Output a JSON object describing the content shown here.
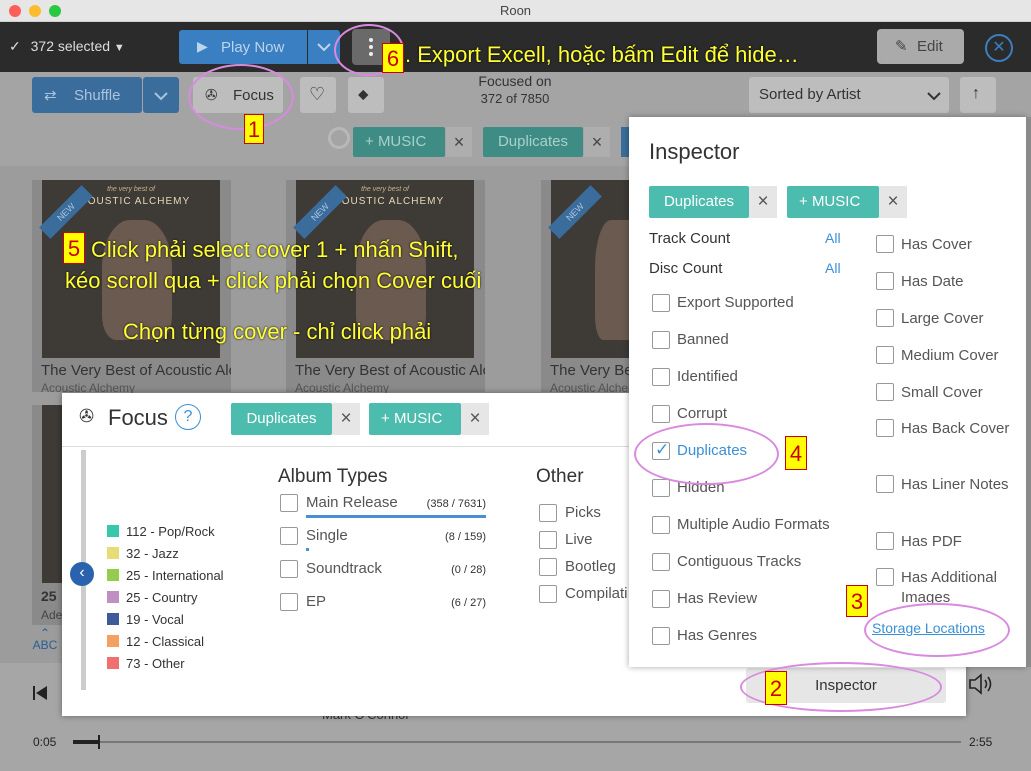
{
  "window": {
    "title": "Roon"
  },
  "toolbar": {
    "selection_label": "372 selected",
    "play_now_label": "Play Now",
    "edit_label": "Edit"
  },
  "filterbar": {
    "shuffle_label": "Shuffle",
    "focus_label": "Focus",
    "focused_on_line1": "Focused on",
    "focused_on_line2": "372 of 7850",
    "sort_label": "Sorted by Artist",
    "chips": [
      "MUSIC",
      "Duplicates"
    ]
  },
  "albums": [
    {
      "title": "The Very Best of Acoustic Alchemy",
      "artist": "Acoustic Alchemy",
      "badge": "NEW",
      "cover_text": "ACOUSTIC ALCHEMY",
      "cover_sub": "the very best of"
    },
    {
      "title": "The Very Best of Acoustic Alchemy",
      "artist": "Acoustic Alchemy",
      "badge": "NEW",
      "cover_text": "ACOUSTIC ALCHEMY",
      "cover_sub": "the very best of"
    },
    {
      "title": "The Very Best of Acoustic Alchemy",
      "artist": "Acoustic Alchemy",
      "badge": "NEW",
      "cover_text": "ACOUSTIC ALCHEMY",
      "cover_sub": "the very best of"
    }
  ],
  "side_partial": {
    "count": "25",
    "artist": "Ade"
  },
  "abc_label": "ABC",
  "focus_panel": {
    "title": "Focus",
    "help": "?",
    "chips": [
      "Duplicates",
      "MUSIC"
    ],
    "legend": [
      {
        "label": "112 - Pop/Rock",
        "color": "#36c8a8"
      },
      {
        "label": "32 - Jazz",
        "color": "#e8dc78"
      },
      {
        "label": "25 - International",
        "color": "#94cc50"
      },
      {
        "label": "25 - Country",
        "color": "#c08ec2"
      },
      {
        "label": "19 - Vocal",
        "color": "#3e5a98"
      },
      {
        "label": "12 - Classical",
        "color": "#f4a060"
      },
      {
        "label": "73 - Other",
        "color": "#f07070"
      }
    ],
    "album_types_heading": "Album Types",
    "album_types": [
      {
        "label": "Main Release",
        "count": "(358 / 7631)",
        "fraction": 1.0
      },
      {
        "label": "Single",
        "count": "(8 / 159)",
        "fraction": 0.02
      },
      {
        "label": "Soundtrack",
        "count": "(0 / 28)",
        "fraction": 0
      },
      {
        "label": "EP",
        "count": "(6 / 27)",
        "fraction": 0
      }
    ],
    "other_heading": "Other",
    "other": [
      "Picks",
      "Live",
      "Bootleg",
      "Compilati"
    ]
  },
  "inspector": {
    "title": "Inspector",
    "chips": [
      "Duplicates",
      "MUSIC"
    ],
    "track_count_label": "Track Count",
    "disc_count_label": "Disc Count",
    "all_label": "All",
    "left_checks": [
      {
        "label": "Export Supported",
        "checked": false
      },
      {
        "label": "Banned",
        "checked": false
      },
      {
        "label": "Identified",
        "checked": false
      },
      {
        "label": "Corrupt",
        "checked": false
      },
      {
        "label": "Duplicates",
        "checked": true
      },
      {
        "label": "Hidden",
        "checked": false
      },
      {
        "label": "Multiple Audio Formats",
        "checked": false
      },
      {
        "label": "Contiguous Tracks",
        "checked": false
      },
      {
        "label": "Has Review",
        "checked": false
      },
      {
        "label": "Has Genres",
        "checked": false
      }
    ],
    "right_checks": [
      {
        "label": "Has Cover"
      },
      {
        "label": "Has Date"
      },
      {
        "label": "Large Cover"
      },
      {
        "label": "Medium Cover"
      },
      {
        "label": "Small Cover"
      },
      {
        "label": "Has Back Cover"
      },
      {
        "label": "Has Liner Notes"
      },
      {
        "label": "Has PDF"
      },
      {
        "label": "Has Additional Images"
      }
    ],
    "storage_link": "Storage Locations",
    "inspector_button": "Inspector"
  },
  "player": {
    "elapsed": "0:05",
    "total": "2:55",
    "artist": "Mark O'Connor"
  },
  "annotations": {
    "n1": "1",
    "n2": "2",
    "n3": "3",
    "n4": "4",
    "n5": "5",
    "n6": "6",
    "note6": ". Export Excell, hoặc bấm Edit để hide…",
    "note5_line1": "Click phải select cover 1 + nhấn Shift,",
    "note5_line2": "kéo scroll qua + click phải chọn Cover cuối",
    "note5_line3": "Chọn từng cover - chỉ click phải"
  }
}
